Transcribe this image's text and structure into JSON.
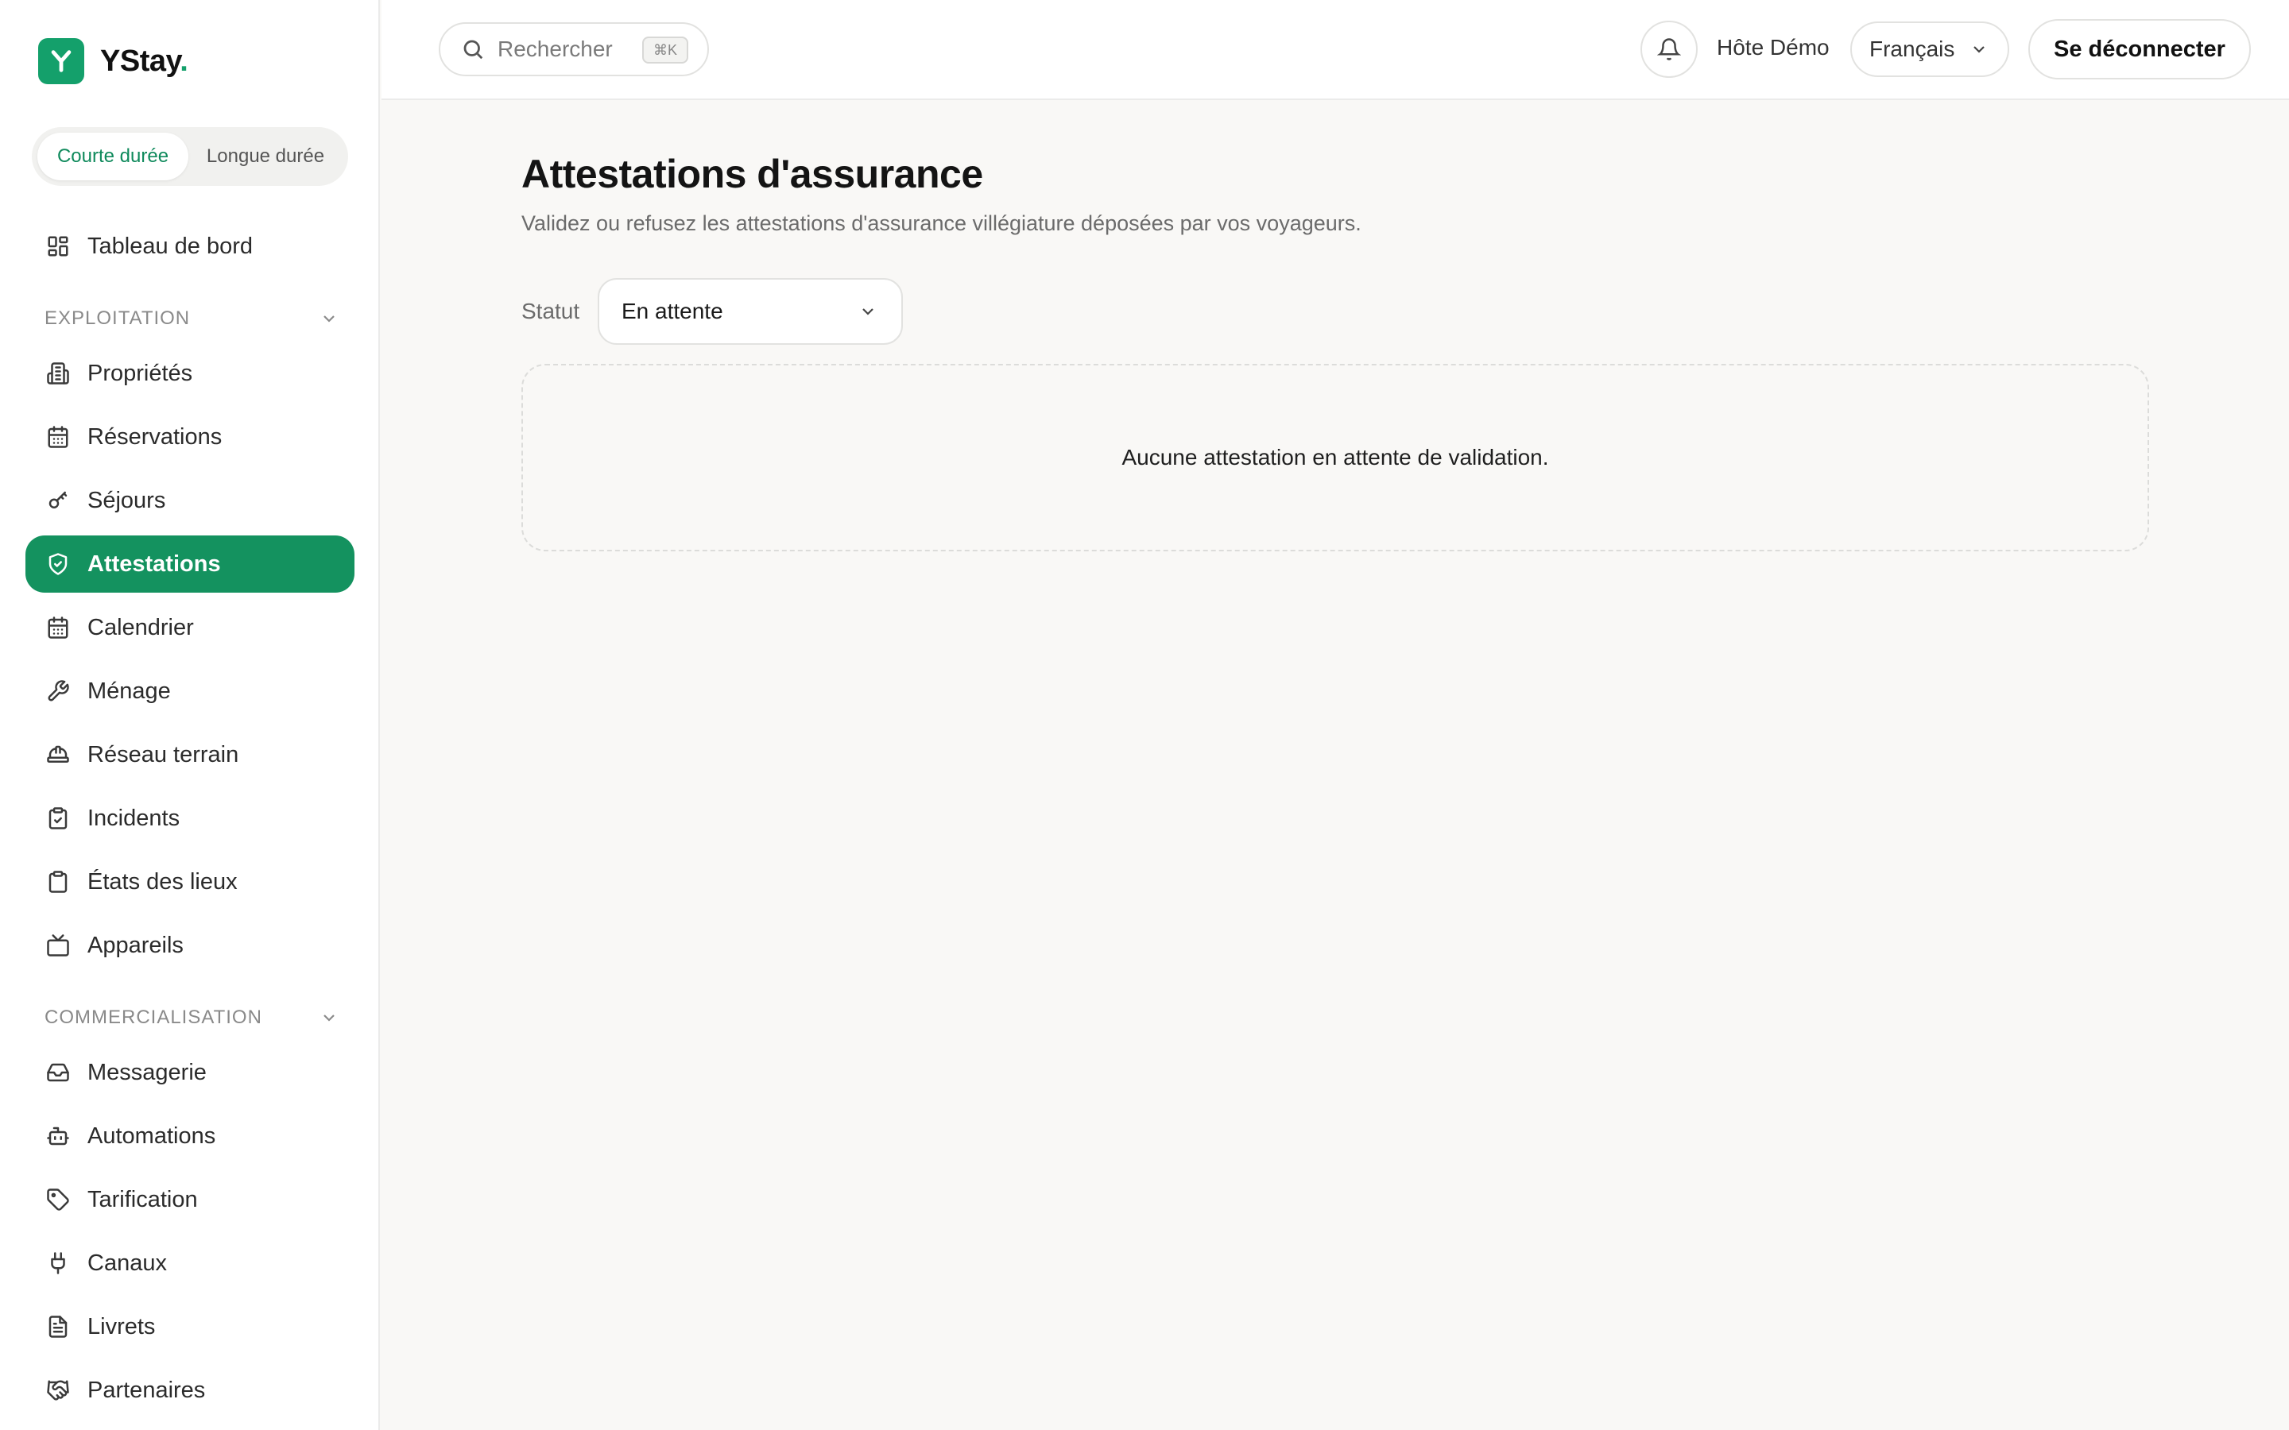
{
  "brand": {
    "name": "YStay",
    "dot": ".",
    "logo_letter": "Y",
    "accent": "#14a06b"
  },
  "mode_toggle": {
    "active": "Courte durée",
    "inactive": "Longue durée"
  },
  "sidebar": {
    "dashboard": {
      "label": "Tableau de bord",
      "icon": "dashboard-icon"
    },
    "sections": [
      {
        "title": "EXPLOITATION"
      },
      {
        "title": "COMMERCIALISATION"
      }
    ],
    "items": [
      {
        "label": "Propriétés",
        "icon": "building-icon"
      },
      {
        "label": "Réservations",
        "icon": "calendar-icon"
      },
      {
        "label": "Séjours",
        "icon": "key-icon"
      },
      {
        "label": "Attestations",
        "icon": "shield-check-icon",
        "active": true
      },
      {
        "label": "Calendrier",
        "icon": "calendar-icon"
      },
      {
        "label": "Ménage",
        "icon": "wrench-icon"
      },
      {
        "label": "Réseau terrain",
        "icon": "hardhat-icon"
      },
      {
        "label": "Incidents",
        "icon": "clipboard-check-icon"
      },
      {
        "label": "États des lieux",
        "icon": "clipboard-icon"
      },
      {
        "label": "Appareils",
        "icon": "tv-icon"
      },
      {
        "label": "Messagerie",
        "icon": "inbox-icon"
      },
      {
        "label": "Automations",
        "icon": "bot-icon"
      },
      {
        "label": "Tarification",
        "icon": "tag-icon"
      },
      {
        "label": "Canaux",
        "icon": "plug-icon"
      },
      {
        "label": "Livrets",
        "icon": "file-text-icon"
      },
      {
        "label": "Partenaires",
        "icon": "handshake-icon"
      }
    ]
  },
  "topbar": {
    "search_placeholder": "Rechercher",
    "search_shortcut": "⌘K",
    "host_name": "Hôte Démo",
    "language": "Français",
    "logout_label": "Se déconnecter"
  },
  "main": {
    "title": "Attestations d'assurance",
    "subtitle": "Validez ou refusez les attestations d'assurance villégiature déposées par vos voyageurs.",
    "filter_label": "Statut",
    "filter_value": "En attente",
    "empty_message": "Aucune attestation en attente de validation."
  },
  "colors": {
    "active_nav": "#14925f",
    "background": "#f9f8f6"
  }
}
